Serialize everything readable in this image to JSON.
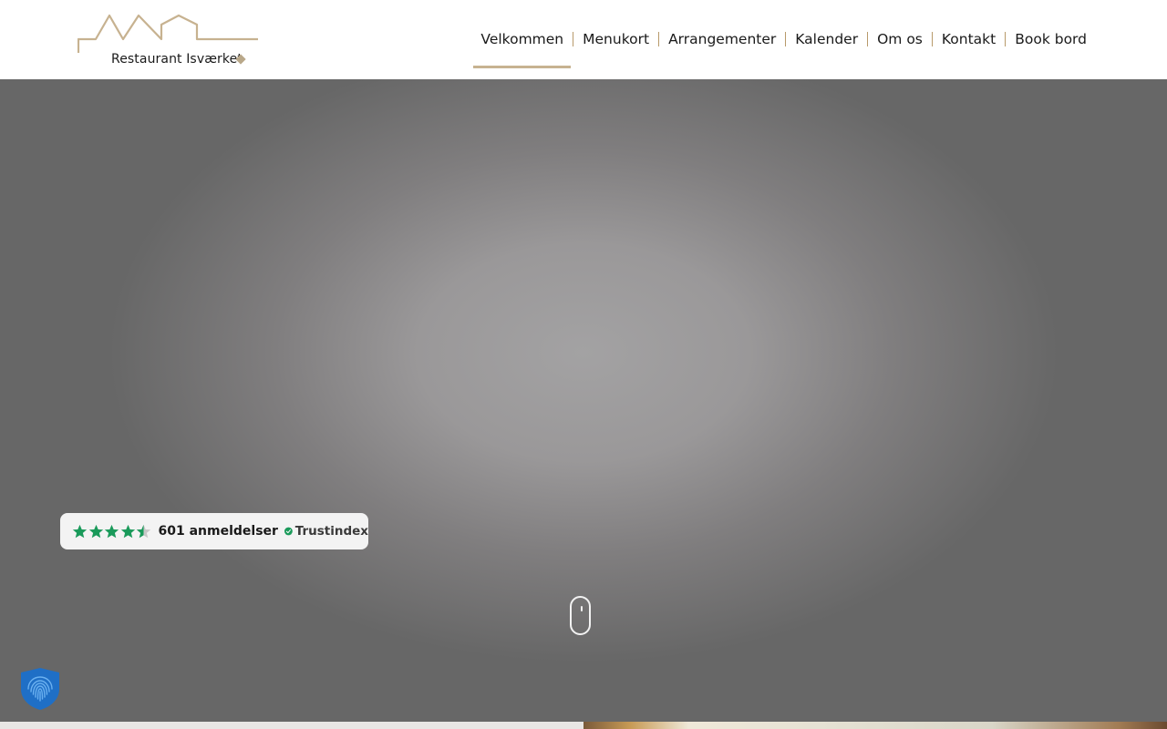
{
  "brand": {
    "name": "Restaurant Isværket",
    "logo_color": "#c7b290"
  },
  "nav": {
    "items": [
      {
        "label": "Velkommen",
        "active": true
      },
      {
        "label": "Menukort",
        "active": false
      },
      {
        "label": "Arrangementer",
        "active": false
      },
      {
        "label": "Kalender",
        "active": false
      },
      {
        "label": "Om os",
        "active": false
      },
      {
        "label": "Kontakt",
        "active": false
      },
      {
        "label": "Book bord",
        "active": false
      }
    ],
    "separator_color": "#b89a6a"
  },
  "trustindex": {
    "rating": 4.5,
    "max_rating": 5,
    "reviews_label": "601 anmeldelser",
    "provider": "Trustindex",
    "star_color": "#1a9a5a"
  },
  "icons": {
    "scroll": "mouse-scroll-icon",
    "privacy": "privacy-shield-fingerprint-icon",
    "verified": "check-circle-icon"
  }
}
